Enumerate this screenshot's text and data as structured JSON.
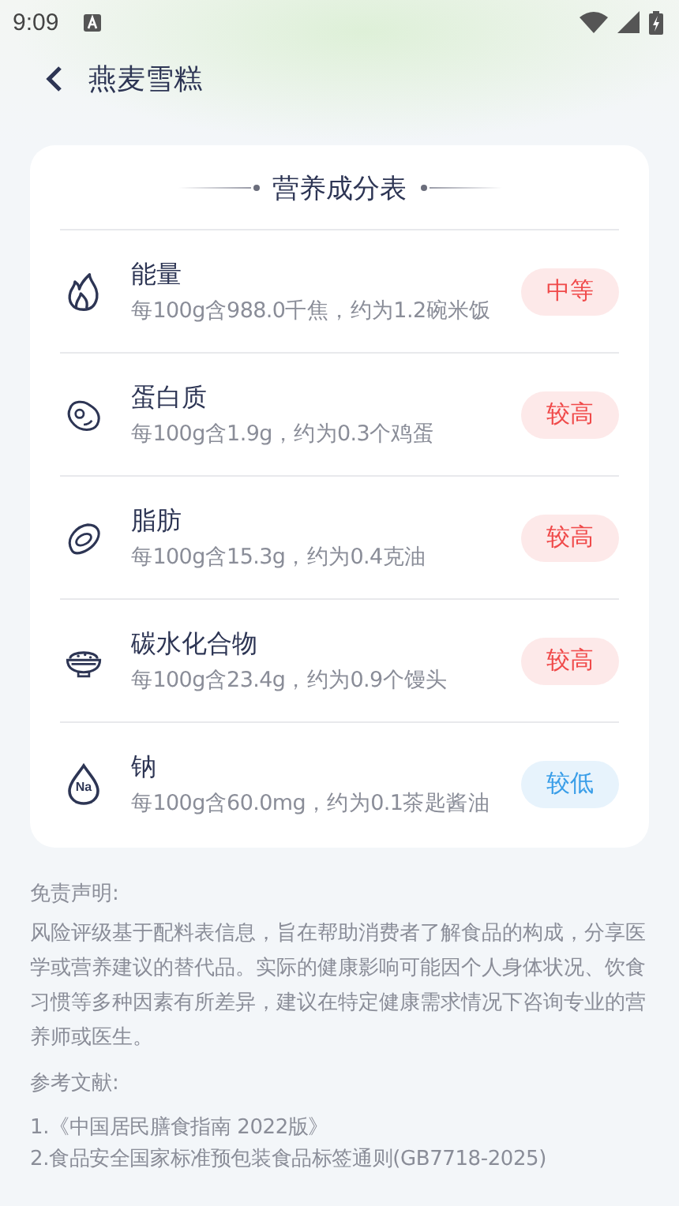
{
  "status_bar": {
    "time": "9:09"
  },
  "header": {
    "title": "燕麦雪糕"
  },
  "card": {
    "title": "营养成分表",
    "items": [
      {
        "kind": "energy",
        "name": "能量",
        "detail": "每100g含988.0千焦，约为1.2碗米饭",
        "color": "#f04a4a",
        "badge": "中等"
      },
      {
        "kind": "protein",
        "name": "蛋白质",
        "detail": "每100g含1.9g，约为0.3个鸡蛋",
        "color": "#f04a4a",
        "badge": "较高"
      },
      {
        "kind": "fat",
        "name": "脂肪",
        "detail": "每100g含15.3g，约为0.4克油",
        "color": "#f04a4a",
        "badge": "较高"
      },
      {
        "kind": "carbs",
        "name": "碳水化合物",
        "detail": "每100g含23.4g，约为0.9个馒头",
        "color": "#f04a4a",
        "badge": "较高"
      },
      {
        "kind": "sodium",
        "name": "钠",
        "detail": "每100g含60.0mg，约为0.1茶匙酱油",
        "color": "#3a9ee8",
        "badge": "较低",
        "icon_text": "Na"
      }
    ]
  },
  "disclaimer": {
    "title": "免责声明:",
    "text": "风险评级基于配料表信息，旨在帮助消费者了解食品的构成，分享医学或营养建议的替代品。实际的健康影响可能因个人身体状况、饮食习惯等多种因素有所差异，建议在特定健康需求情况下咨询专业的营养师或医生。"
  },
  "references": {
    "title": "参考文献:",
    "items": [
      "1.《中国居民膳食指南 2022版》",
      "2.食品安全国家标准预包装食品标签通则(GB7718-2025)"
    ]
  }
}
